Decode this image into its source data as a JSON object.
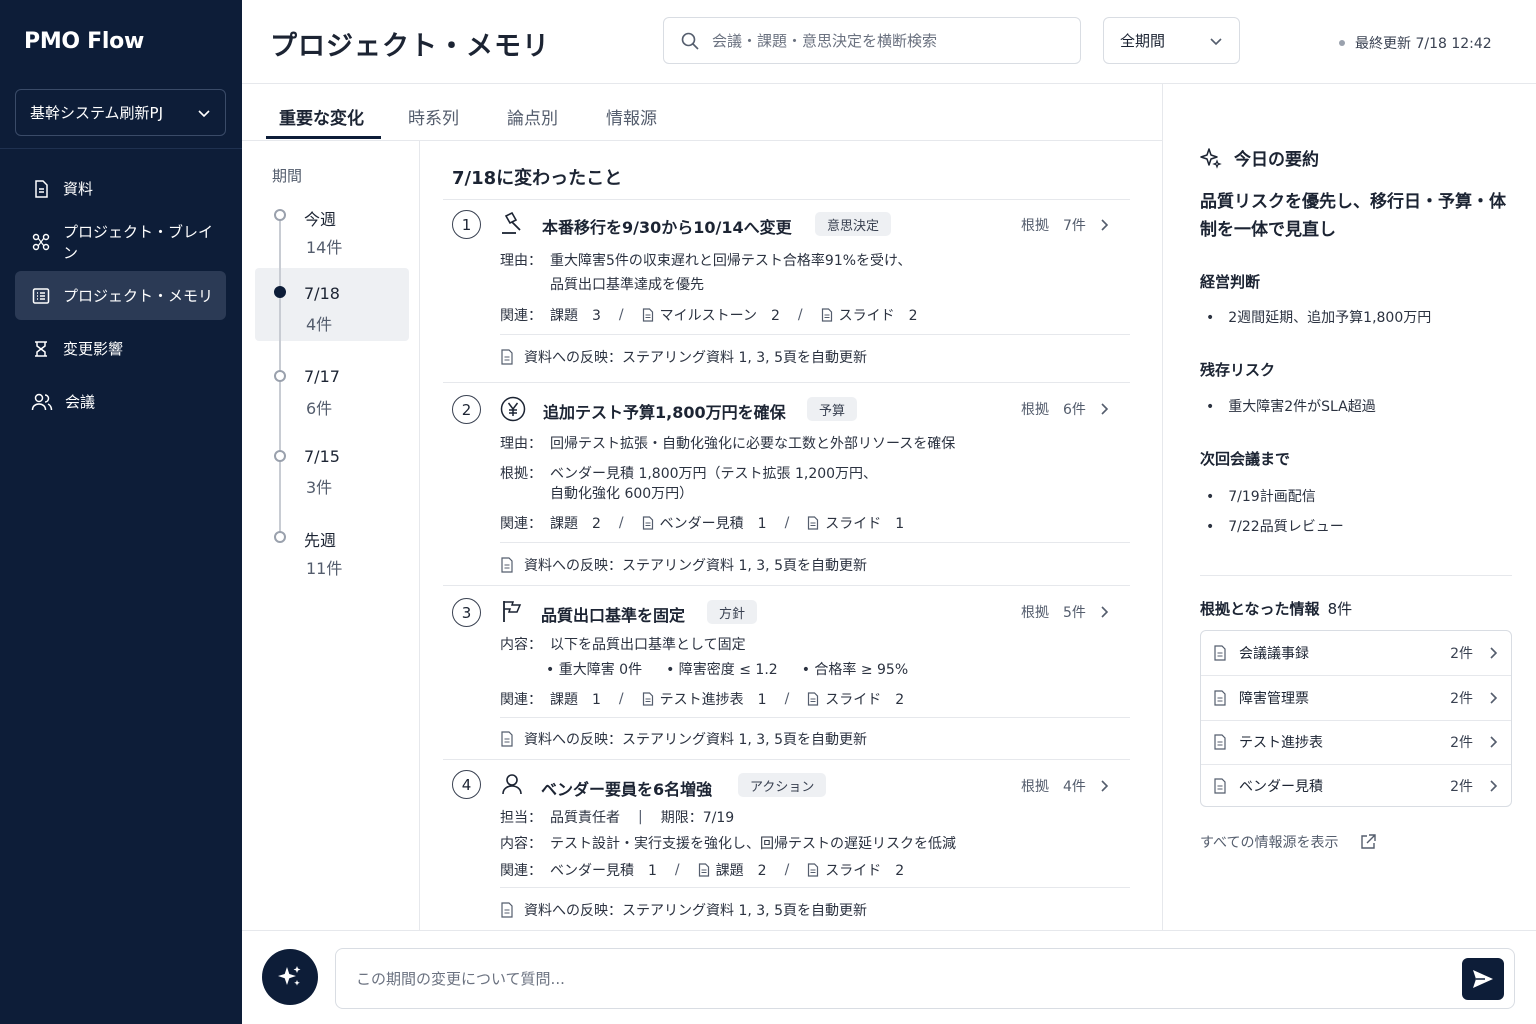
{
  "app": {
    "brand": "PMO Flow",
    "project": "基幹システム刷新PJ"
  },
  "nav": [
    {
      "label": "資料",
      "icon": "document-icon"
    },
    {
      "label": "プロジェクト・ブレイン",
      "icon": "network-icon"
    },
    {
      "label": "プロジェクト・メモリ",
      "icon": "list-icon"
    },
    {
      "label": "変更影響",
      "icon": "impact-icon"
    },
    {
      "label": "会議",
      "icon": "people-icon"
    }
  ],
  "header": {
    "title": "プロジェクト・メモリ",
    "search_placeholder": "会議・課題・意思決定を横断検索",
    "period": "全期間",
    "updated": "最終更新 7/18 12:42"
  },
  "tabs": [
    "重要な変化",
    "時系列",
    "論点別",
    "情報源"
  ],
  "timeline": {
    "title": "期間",
    "items": [
      {
        "date": "今週",
        "count": "14件"
      },
      {
        "date": "7/18",
        "count": "4件"
      },
      {
        "date": "7/17",
        "count": "6件"
      },
      {
        "date": "7/15",
        "count": "3件"
      },
      {
        "date": "先週",
        "count": "11件"
      }
    ]
  },
  "feed": {
    "title": "7/18に変わったこと",
    "cards": [
      {
        "num": "1",
        "title": "本番移行を9/30から10/14へ変更",
        "badge": "意思決定",
        "evidence": "根拠　7件",
        "reason_label": "理由：",
        "reason_1": "重大障害5件の収束遅れと回帰テスト合格率91%を受け、",
        "reason_2": "品質出口基準達成を優先",
        "rel_label": "関連：",
        "rel_1": "課題　3",
        "rel_2": "マイルストーン　2",
        "rel_3": "スライド　2",
        "reflection": "資料への反映：ステアリング資料 1, 3, 5頁を自動更新"
      },
      {
        "num": "2",
        "title": "追加テスト予算1,800万円を確保",
        "badge": "予算",
        "evidence": "根拠　6件",
        "reason_label": "理由：",
        "reason_1": "回帰テスト拡張・自動化強化に必要な工数と外部リソースを確保",
        "basis_label": "根拠：",
        "basis_1": "ベンダー見積 1,800万円（テスト拡張 1,200万円、",
        "basis_2": "自動化強化 600万円）",
        "rel_label": "関連：",
        "rel_1": "課題　2",
        "rel_2": "ベンダー見積　1",
        "rel_3": "スライド　1",
        "reflection": "資料への反映：ステアリング資料 1, 3, 5頁を自動更新"
      },
      {
        "num": "3",
        "title": "品質出口基準を固定",
        "badge": "方針",
        "evidence": "根拠　5件",
        "content_label": "内容：",
        "content_1": "以下を品質出口基準として固定",
        "criteria": [
          "• 重大障害 0件",
          "• 障害密度 ≤ 1.2",
          "• 合格率 ≥ 95%"
        ],
        "rel_label": "関連：",
        "rel_1": "課題　1",
        "rel_2": "テスト進捗表　1",
        "rel_3": "スライド　2",
        "reflection": "資料への反映：ステアリング資料 1, 3, 5頁を自動更新"
      },
      {
        "num": "4",
        "title": "ベンダー要員を6名増強",
        "badge": "アクション",
        "evidence": "根拠　4件",
        "owner_label": "担当：",
        "owner": "品質責任者",
        "due": "期限：7/19",
        "content_label": "内容：",
        "content_1": "テスト設計・実行支援を強化し、回帰テストの遅延リスクを低減",
        "rel_label": "関連：",
        "rel_1": "ベンダー見積　1",
        "rel_2": "課題　2",
        "rel_3": "スライド　2",
        "reflection": "資料への反映：ステアリング資料 1, 3, 5頁を自動更新"
      }
    ]
  },
  "summary": {
    "title": "今日の要約",
    "headline": "品質リスクを優先し、移行日・予算・体制を一体で見直し",
    "sections": [
      {
        "heading": "経営判断",
        "bullets": [
          "2週間延期、追加予算1,800万円"
        ]
      },
      {
        "heading": "残存リスク",
        "bullets": [
          "重大障害2件がSLA超過"
        ]
      },
      {
        "heading": "次回会議まで",
        "bullets": [
          "7/19計画配信",
          "7/22品質レビュー"
        ]
      }
    ],
    "sources_title": "根拠となった情報",
    "sources_count": "8件",
    "sources": [
      {
        "name": "会議議事録",
        "count": "2件"
      },
      {
        "name": "障害管理票",
        "count": "2件"
      },
      {
        "name": "テスト進捗表",
        "count": "2件"
      },
      {
        "name": "ベンダー見積",
        "count": "2件"
      }
    ],
    "all_sources": "すべての情報源を表示"
  },
  "chat": {
    "placeholder": "この期間の変更について質問..."
  }
}
